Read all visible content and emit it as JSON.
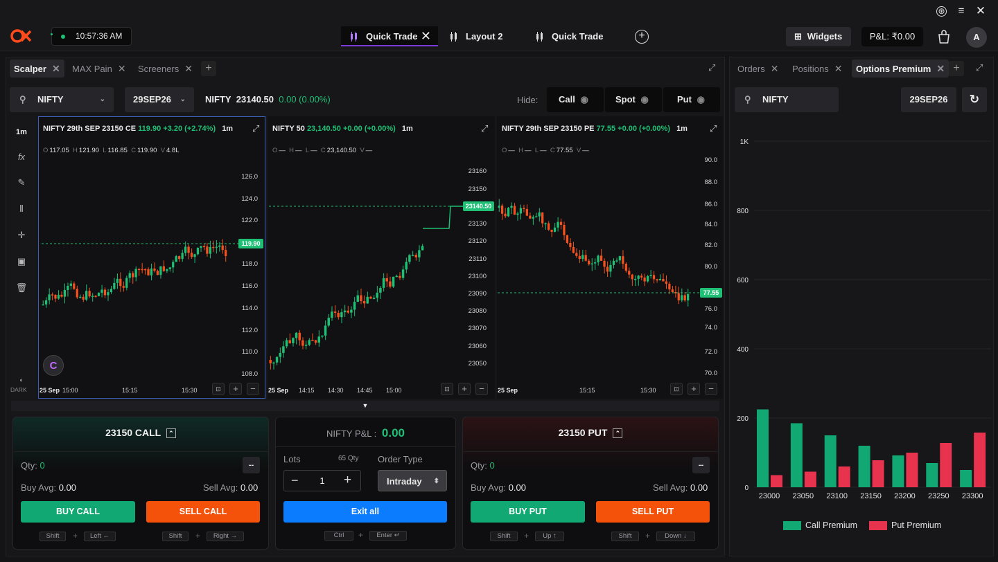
{
  "clock": "10:57:36 AM",
  "top_tabs": [
    {
      "label": "Quick Trade",
      "active": true
    },
    {
      "label": "Layout 2",
      "active": false
    },
    {
      "label": "Quick Trade",
      "active": false
    }
  ],
  "header": {
    "widgets": "Widgets",
    "pnl": "P&L: ₹0.00",
    "avatar": "A"
  },
  "left_tabs": [
    "Scalper",
    "MAX Pain",
    "Screeners"
  ],
  "toolbar": {
    "symbol": "NIFTY",
    "expiry": "29SEP26",
    "spot_symbol": "NIFTY",
    "spot_price": "23140.50",
    "spot_change": "0.00 (0.00%)",
    "hide_label": "Hide:",
    "hide_call": "Call",
    "hide_spot": "Spot",
    "hide_put": "Put"
  },
  "side_tools": {
    "interval": "1m",
    "theme": "DARK"
  },
  "charts": [
    {
      "title": "NIFTY 29th SEP 23150 CE",
      "price": "119.90",
      "change": "+3.20 (+2.74%)",
      "interval": "1m",
      "ohlc": {
        "o": "117.05",
        "h": "121.90",
        "l": "116.85",
        "c": "119.90",
        "v": "4.8L"
      },
      "yticks": [
        "126.0",
        "124.0",
        "122.0",
        "118.0",
        "116.0",
        "114.0",
        "112.0",
        "110.0",
        "108.0"
      ],
      "last_tag": "119.90",
      "xdate": "25 Sep",
      "xticks": [
        "15:00",
        "15:15",
        "15:30"
      ]
    },
    {
      "title": "NIFTY 50",
      "price": "23,140.50",
      "change": "+0.00 (+0.00%)",
      "interval": "1m",
      "ohlc": {
        "o": "—",
        "h": "—",
        "l": "—",
        "c": "23,140.50",
        "v": "—"
      },
      "yticks": [
        "23160",
        "23150",
        "23130",
        "23120",
        "23110",
        "23100",
        "23090",
        "23080",
        "23070",
        "23060",
        "23050"
      ],
      "last_tag": "23140.50",
      "xdate": "25 Sep",
      "xticks": [
        "14:15",
        "14:30",
        "14:45",
        "15:00"
      ]
    },
    {
      "title": "NIFTY 29th SEP 23150 PE",
      "price": "77.55",
      "change": "+0.00 (+0.00%)",
      "interval": "1m",
      "ohlc": {
        "o": "—",
        "h": "—",
        "l": "—",
        "c": "77.55",
        "v": "—"
      },
      "yticks": [
        "90.0",
        "88.0",
        "86.0",
        "84.0",
        "82.0",
        "80.0",
        "76.0",
        "74.0",
        "72.0",
        "70.0"
      ],
      "last_tag": "77.55",
      "xdate": "25 Sep",
      "xticks": [
        "15:15",
        "15:30"
      ]
    }
  ],
  "call_card": {
    "title": "23150 CALL",
    "qty_label": "Qty:",
    "qty": "0",
    "dash": "--",
    "buy_avg_label": "Buy Avg:",
    "buy_avg": "0.00",
    "sell_avg_label": "Sell Avg:",
    "sell_avg": "0.00",
    "buy_btn": "BUY CALL",
    "sell_btn": "SELL CALL",
    "kbd_buy": [
      "Shift",
      "Left ←"
    ],
    "kbd_sell": [
      "Shift",
      "Right →"
    ]
  },
  "mid_card": {
    "pnl_label": "NIFTY P&L :",
    "pnl": "0.00",
    "lots_label": "Lots",
    "lots_qty": "65 Qty",
    "order_type_label": "Order Type",
    "lots": "1",
    "order_type": "Intraday",
    "exit_btn": "Exit all",
    "kbd": [
      "Ctrl",
      "Enter ↵"
    ]
  },
  "put_card": {
    "title": "23150 PUT",
    "qty_label": "Qty:",
    "qty": "0",
    "dash": "--",
    "buy_avg_label": "Buy Avg:",
    "buy_avg": "0.00",
    "sell_avg_label": "Sell Avg:",
    "sell_avg": "0.00",
    "buy_btn": "BUY PUT",
    "sell_btn": "SELL PUT",
    "kbd_buy": [
      "Shift",
      "Up ↑"
    ],
    "kbd_sell": [
      "Shift",
      "Down ↓"
    ]
  },
  "right_tabs": [
    "Orders",
    "Positions",
    "Options Premium"
  ],
  "right_toolbar": {
    "symbol": "NIFTY",
    "expiry": "29SEP26"
  },
  "colors": {
    "call": "#11a874",
    "put": "#e8334f",
    "accent": "#7b3bdc",
    "up": "#1fbf75",
    "down": "#f4511e"
  },
  "chart_data": {
    "type": "bar",
    "categories": [
      "23000",
      "23050",
      "23100",
      "23150",
      "23200",
      "23250",
      "23300"
    ],
    "series": [
      {
        "name": "Call Premium",
        "values": [
          225,
          185,
          150,
          120,
          92,
          70,
          50
        ]
      },
      {
        "name": "Put Premium",
        "values": [
          35,
          45,
          60,
          78,
          100,
          128,
          158
        ]
      }
    ],
    "yticks": [
      "1K",
      "800",
      "600",
      "400",
      "200",
      "0"
    ],
    "ylim": [
      0,
      1000
    ],
    "legend": "bottom"
  }
}
